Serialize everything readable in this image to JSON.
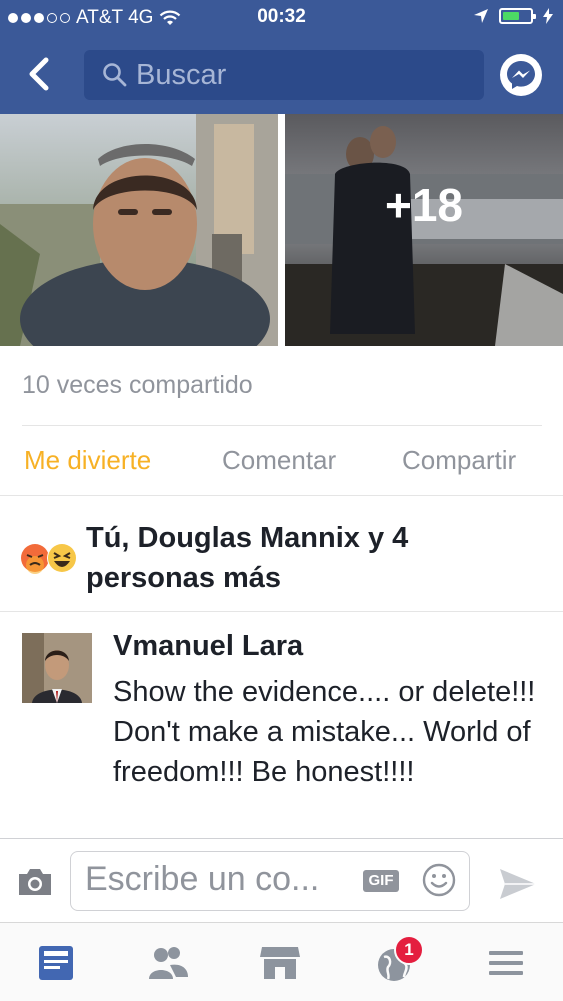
{
  "status_bar": {
    "carrier": "AT&T 4G",
    "time": "00:32",
    "signal_filled": 3,
    "signal_total": 5,
    "battery_level": 0.55
  },
  "nav": {
    "search_placeholder": "Buscar"
  },
  "post": {
    "more_photos": "+18",
    "shares": "10 veces compartido",
    "actions": {
      "react": "Me divierte",
      "comment": "Comentar",
      "share": "Compartir"
    },
    "reactions_text": "Tú, Douglas Mannix y 4 personas más"
  },
  "comment": {
    "author": "Vmanuel Lara",
    "text": "Show the evidence.... or delete!!! Don't make a mistake... World of freedom!!! Be honest!!!!"
  },
  "composer": {
    "placeholder": "Escribe un co...",
    "gif_label": "GIF"
  },
  "tabbar": {
    "notification_count": "1"
  },
  "colors": {
    "brand": "#3b5998",
    "react_active": "#f7b125",
    "muted": "#90949c",
    "badge": "#e41e3f"
  },
  "icons": [
    "back-chevron-icon",
    "search-icon",
    "messenger-icon",
    "camera-icon",
    "smiley-icon",
    "send-icon",
    "news-feed-icon",
    "friends-icon",
    "marketplace-icon",
    "notifications-globe-icon",
    "menu-icon",
    "angry-emoji-icon",
    "laugh-emoji-icon"
  ]
}
